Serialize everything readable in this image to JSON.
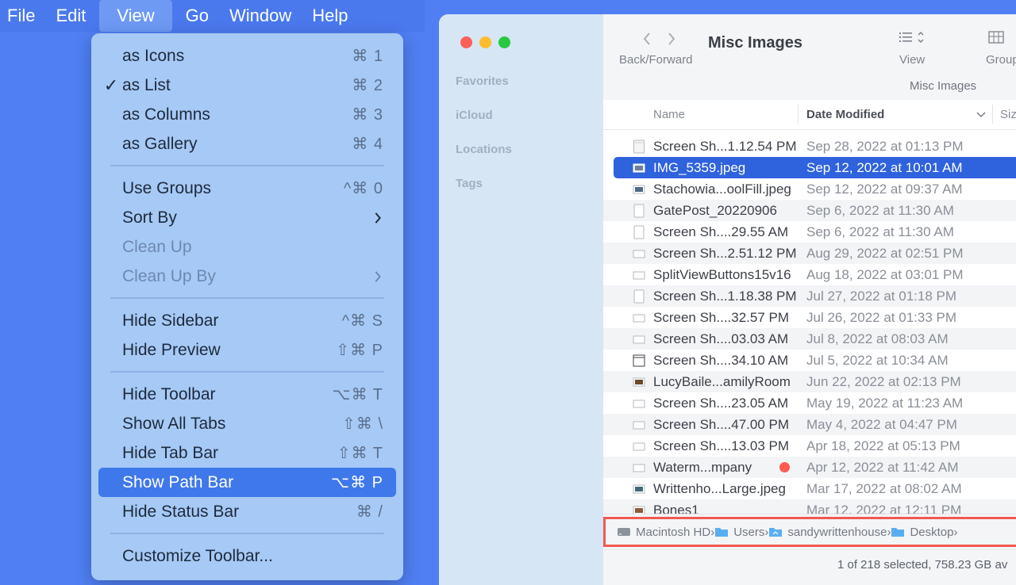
{
  "menubar": {
    "items": [
      "File",
      "Edit",
      "View",
      "Go",
      "Window",
      "Help"
    ],
    "active": "View"
  },
  "view_menu": {
    "items": [
      {
        "label": "as Icons",
        "shortcut": "⌘ 1"
      },
      {
        "label": "as List",
        "shortcut": "⌘ 2",
        "checked": "✓"
      },
      {
        "label": "as Columns",
        "shortcut": "⌘ 3"
      },
      {
        "label": "as Gallery",
        "shortcut": "⌘ 4"
      },
      {
        "label": "Use Groups",
        "shortcut": "^⌘ 0"
      },
      {
        "label": "Sort By",
        "shortcut": ""
      },
      {
        "label": "Clean Up",
        "shortcut": ""
      },
      {
        "label": "Clean Up By",
        "shortcut": ""
      },
      {
        "label": "Hide Sidebar",
        "shortcut": "^⌘ S"
      },
      {
        "label": "Hide Preview",
        "shortcut": "⇧⌘ P"
      },
      {
        "label": "Hide Toolbar",
        "shortcut": "⌥⌘ T"
      },
      {
        "label": "Show All Tabs",
        "shortcut": "⇧⌘ \\"
      },
      {
        "label": "Hide Tab Bar",
        "shortcut": "⇧⌘ T"
      },
      {
        "label": "Show Path Bar",
        "shortcut": "⌥⌘ P"
      },
      {
        "label": "Hide Status Bar",
        "shortcut": "⌘ /"
      },
      {
        "label": "Customize Toolbar...",
        "shortcut": ""
      }
    ]
  },
  "finder": {
    "sidebar_sections": [
      "Favorites",
      "iCloud",
      "Locations",
      "Tags"
    ],
    "toolbar": {
      "back_forward_label": "Back/Forward",
      "title": "Misc Images",
      "view_label": "View",
      "group_label": "Group",
      "subtitle": "Misc Images"
    },
    "columns": {
      "name": "Name",
      "date": "Date Modified",
      "size": "Size"
    },
    "files": [
      {
        "name": "Screen Sh...1.12.54 PM",
        "date": "Sep 28, 2022 at 01:13 PM"
      },
      {
        "name": "IMG_5359.jpeg",
        "date": "Sep 12, 2022 at 10:01 AM"
      },
      {
        "name": "Stachowia...oolFill.jpeg",
        "date": "Sep 12, 2022 at 09:37 AM"
      },
      {
        "name": "GatePost_20220906",
        "date": "Sep 6, 2022 at 11:30 AM"
      },
      {
        "name": "Screen Sh....29.55 AM",
        "date": "Sep 6, 2022 at 11:30 AM"
      },
      {
        "name": "Screen Sh...2.51.12 PM",
        "date": "Aug 29, 2022 at 02:51 PM"
      },
      {
        "name": "SplitViewButtons15v16",
        "date": "Aug 18, 2022 at 03:01 PM"
      },
      {
        "name": "Screen Sh...1.18.38 PM",
        "date": "Jul 27, 2022 at 01:18 PM"
      },
      {
        "name": "Screen Sh....32.57 PM",
        "date": "Jul 26, 2022 at 01:33 PM"
      },
      {
        "name": "Screen Sh....03.03 AM",
        "date": "Jul 8, 2022 at 08:03 AM"
      },
      {
        "name": "Screen Sh....34.10 AM",
        "date": "Jul 5, 2022 at 10:34 AM"
      },
      {
        "name": "LucyBaile...amilyRoom",
        "date": "Jun 22, 2022 at 02:13 PM"
      },
      {
        "name": "Screen Sh....23.05 AM",
        "date": "May 19, 2022 at 11:23 AM"
      },
      {
        "name": "Screen Sh....47.00 PM",
        "date": "May 4, 2022 at 04:47 PM"
      },
      {
        "name": "Screen Sh....13.03 PM",
        "date": "Apr 18, 2022 at 05:13 PM"
      },
      {
        "name": "Waterm...mpany",
        "date": "Apr 12, 2022 at 11:42 AM",
        "tag": "red"
      },
      {
        "name": "Writtenho...Large.jpeg",
        "date": "Mar 17, 2022 at 08:02 AM"
      },
      {
        "name": "Bones1",
        "date": "Mar 12, 2022 at 12:11 PM"
      }
    ],
    "selected_index": 1,
    "path": [
      "Macintosh HD",
      "Users",
      "sandywrittenhouse",
      "Desktop"
    ],
    "status": "1 of 218 selected, 758.23 GB av"
  },
  "colors": {
    "desktop": "#4f7ff3",
    "menu_bg": "#a6c9f6",
    "highlight": "#3f78ea",
    "selection": "#2f62dd",
    "path_outline": "#ef5a4f",
    "light_red": "#fe5f57",
    "light_yellow": "#febc2e",
    "light_green": "#28c840"
  }
}
